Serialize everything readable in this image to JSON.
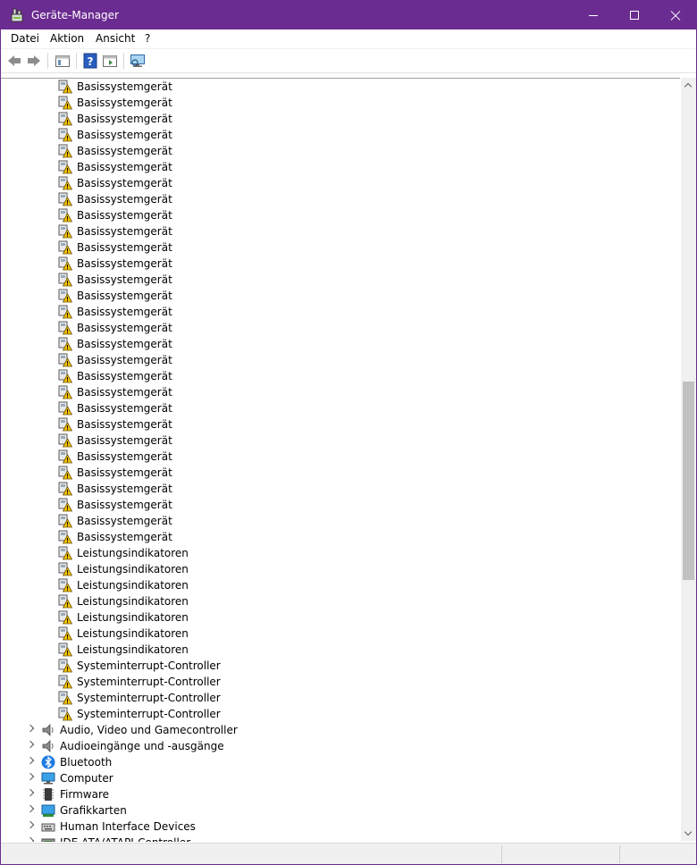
{
  "window": {
    "title": "Geräte-Manager",
    "accent": "#6b2c91"
  },
  "menu": [
    "Datei",
    "Aktion",
    "Ansicht",
    "?"
  ],
  "toolbar": [
    "back-icon",
    "forward-icon",
    "properties-pane-icon",
    "help-icon",
    "action-pane-icon",
    "scan-hardware-icon"
  ],
  "device_children": [
    {
      "label": "Basissystemgerät",
      "icon": "warning-device-icon"
    },
    {
      "label": "Basissystemgerät",
      "icon": "warning-device-icon"
    },
    {
      "label": "Basissystemgerät",
      "icon": "warning-device-icon"
    },
    {
      "label": "Basissystemgerät",
      "icon": "warning-device-icon"
    },
    {
      "label": "Basissystemgerät",
      "icon": "warning-device-icon"
    },
    {
      "label": "Basissystemgerät",
      "icon": "warning-device-icon"
    },
    {
      "label": "Basissystemgerät",
      "icon": "warning-device-icon"
    },
    {
      "label": "Basissystemgerät",
      "icon": "warning-device-icon"
    },
    {
      "label": "Basissystemgerät",
      "icon": "warning-device-icon"
    },
    {
      "label": "Basissystemgerät",
      "icon": "warning-device-icon"
    },
    {
      "label": "Basissystemgerät",
      "icon": "warning-device-icon"
    },
    {
      "label": "Basissystemgerät",
      "icon": "warning-device-icon"
    },
    {
      "label": "Basissystemgerät",
      "icon": "warning-device-icon"
    },
    {
      "label": "Basissystemgerät",
      "icon": "warning-device-icon"
    },
    {
      "label": "Basissystemgerät",
      "icon": "warning-device-icon"
    },
    {
      "label": "Basissystemgerät",
      "icon": "warning-device-icon"
    },
    {
      "label": "Basissystemgerät",
      "icon": "warning-device-icon"
    },
    {
      "label": "Basissystemgerät",
      "icon": "warning-device-icon"
    },
    {
      "label": "Basissystemgerät",
      "icon": "warning-device-icon"
    },
    {
      "label": "Basissystemgerät",
      "icon": "warning-device-icon"
    },
    {
      "label": "Basissystemgerät",
      "icon": "warning-device-icon"
    },
    {
      "label": "Basissystemgerät",
      "icon": "warning-device-icon"
    },
    {
      "label": "Basissystemgerät",
      "icon": "warning-device-icon"
    },
    {
      "label": "Basissystemgerät",
      "icon": "warning-device-icon"
    },
    {
      "label": "Basissystemgerät",
      "icon": "warning-device-icon"
    },
    {
      "label": "Basissystemgerät",
      "icon": "warning-device-icon"
    },
    {
      "label": "Basissystemgerät",
      "icon": "warning-device-icon"
    },
    {
      "label": "Basissystemgerät",
      "icon": "warning-device-icon"
    },
    {
      "label": "Basissystemgerät",
      "icon": "warning-device-icon"
    },
    {
      "label": "Leistungsindikatoren",
      "icon": "warning-device-icon"
    },
    {
      "label": "Leistungsindikatoren",
      "icon": "warning-device-icon"
    },
    {
      "label": "Leistungsindikatoren",
      "icon": "warning-device-icon"
    },
    {
      "label": "Leistungsindikatoren",
      "icon": "warning-device-icon"
    },
    {
      "label": "Leistungsindikatoren",
      "icon": "warning-device-icon"
    },
    {
      "label": "Leistungsindikatoren",
      "icon": "warning-device-icon"
    },
    {
      "label": "Leistungsindikatoren",
      "icon": "warning-device-icon"
    },
    {
      "label": "Systeminterrupt-Controller",
      "icon": "warning-device-icon"
    },
    {
      "label": "Systeminterrupt-Controller",
      "icon": "warning-device-icon"
    },
    {
      "label": "Systeminterrupt-Controller",
      "icon": "warning-device-icon"
    },
    {
      "label": "Systeminterrupt-Controller",
      "icon": "warning-device-icon"
    }
  ],
  "categories": [
    {
      "label": "Audio, Video und Gamecontroller",
      "icon": "speaker-icon"
    },
    {
      "label": "Audioeingänge und -ausgänge",
      "icon": "speaker-icon"
    },
    {
      "label": "Bluetooth",
      "icon": "bluetooth-icon"
    },
    {
      "label": "Computer",
      "icon": "monitor-icon"
    },
    {
      "label": "Firmware",
      "icon": "chip-icon"
    },
    {
      "label": "Grafikkarten",
      "icon": "display-adapter-icon"
    },
    {
      "label": "Human Interface Devices",
      "icon": "keyboard-icon"
    },
    {
      "label": "IDE ATA/ATAPI-Controller",
      "icon": "ide-controller-icon"
    }
  ]
}
